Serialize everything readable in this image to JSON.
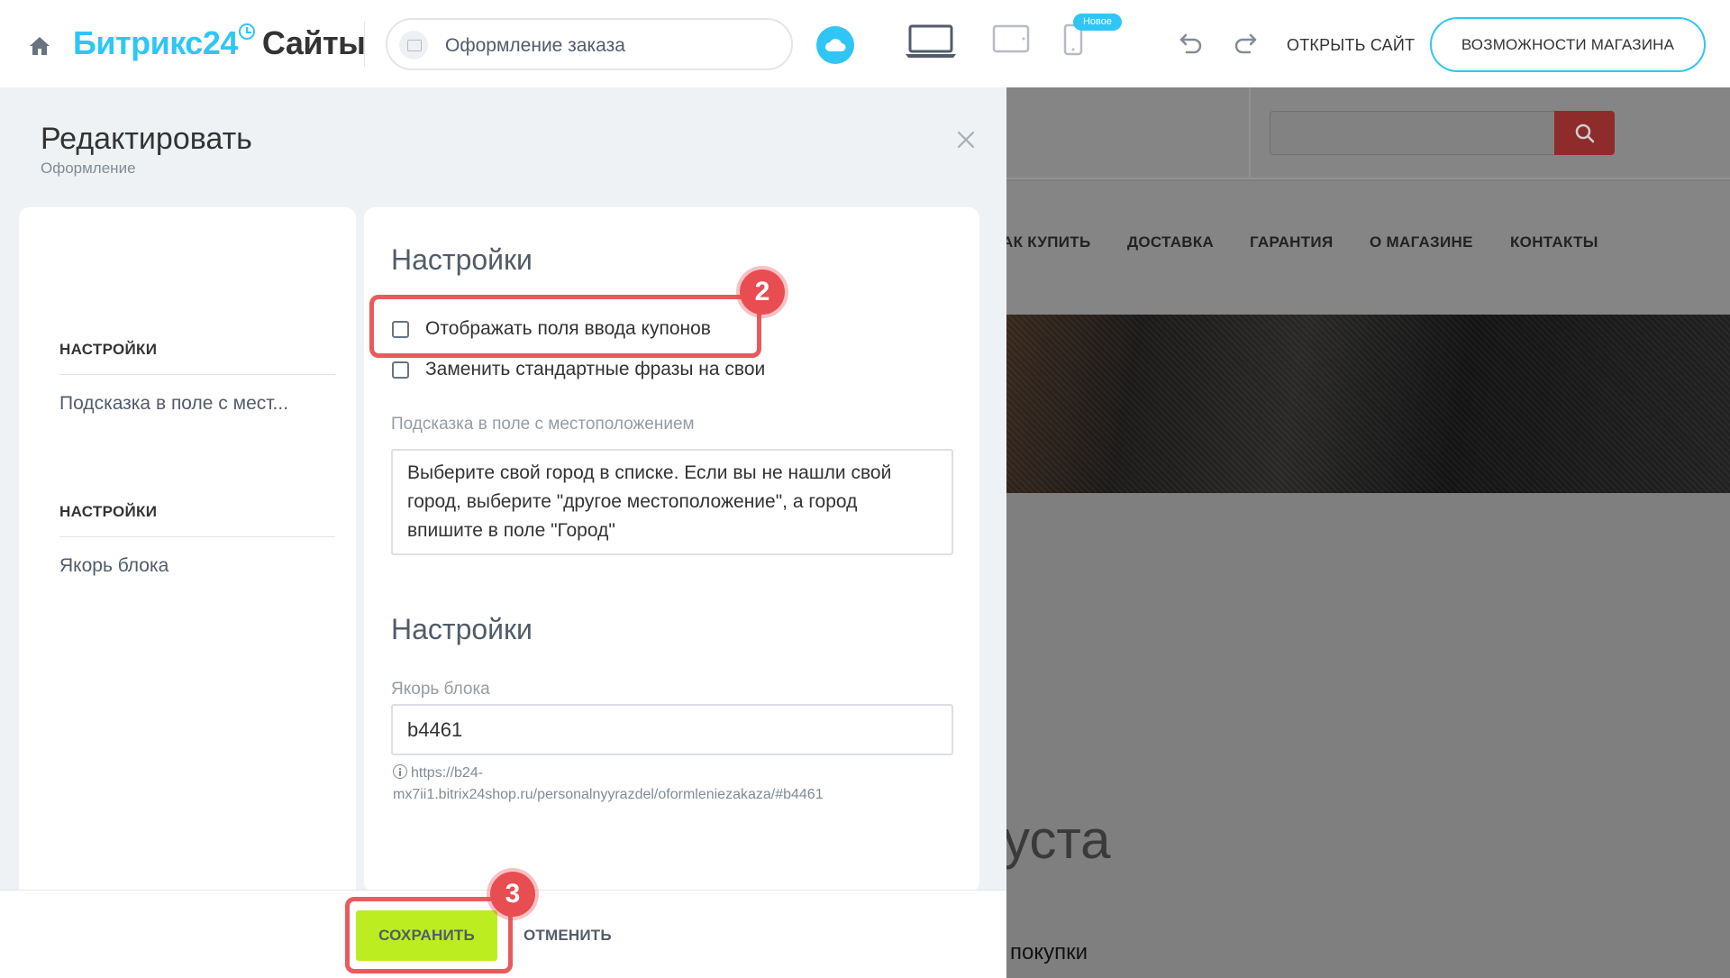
{
  "header": {
    "logo_brand": "Битрикс24",
    "logo_product": "Сайты",
    "page_name": "Оформление заказа",
    "new_badge": "Новое",
    "open_site": "ОТКРЫТЬ САЙТ",
    "shop_features": "ВОЗМОЖНОСТИ МАГАЗИНА"
  },
  "panel": {
    "title": "Редактировать",
    "subtitle": "Оформление",
    "nav": [
      {
        "title": "НАСТРОЙКИ",
        "link": "Подсказка в поле с мест..."
      },
      {
        "title": "НАСТРОЙКИ",
        "link": "Якорь блока"
      }
    ],
    "section1": {
      "title": "Настройки",
      "checkbox_coupons": {
        "label": "Отображать поля ввода купонов",
        "checked": false
      },
      "checkbox_phrases": {
        "label": "Заменить стандартные фразы на свои",
        "checked": false
      },
      "location_hint_label": "Подсказка в поле с местоположением",
      "location_hint_value": "Выберите свой город в списке. Если вы не нашли свой\nгород, выберите \"другое местоположение\", а город\nвпишите в поле \"Город\""
    },
    "section2": {
      "title": "Настройки",
      "anchor_label": "Якорь блока",
      "anchor_value": "b4461",
      "anchor_url_line1": "https://b24-",
      "anchor_url_line2": "mx7ii1.bitrix24shop.ru/personalnyyrazdel/oformleniezakaza/#b4461"
    }
  },
  "footer": {
    "save_label": "СОХРАНИТЬ",
    "cancel_label": "ОТМЕНИТЬ"
  },
  "annotations": {
    "step_coupons": "2",
    "step_save": "3",
    "color": "#e95a5d"
  },
  "preview": {
    "nav": [
      "АК КУПИТЬ",
      "ДОСТАВКА",
      "ГАРАНТИЯ",
      "О МАГАЗИНЕ",
      "КОНТАКТЫ"
    ],
    "heading_fragment": "уста",
    "sub_fragment": "покупки"
  },
  "icons": {
    "home": "home-icon",
    "cloud": "cloud-icon",
    "desktop": "desktop-icon",
    "tablet": "tablet-icon",
    "mobile": "mobile-icon",
    "undo": "undo-icon",
    "redo": "redo-icon",
    "close": "close-icon",
    "search": "search-icon",
    "info": "info-icon"
  },
  "colors": {
    "accent": "#2fc6f6",
    "save": "#bbed21",
    "search_button": "#8e2c2c"
  }
}
